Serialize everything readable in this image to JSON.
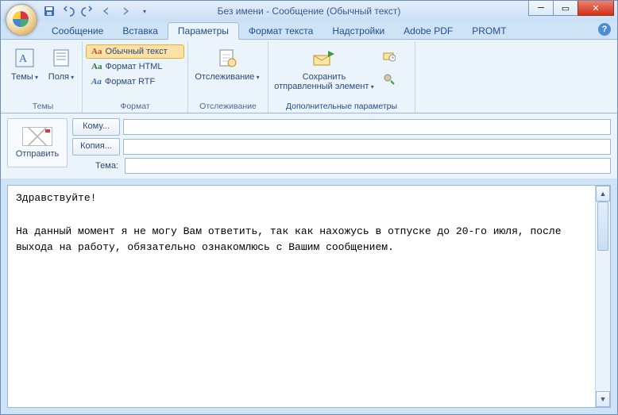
{
  "title": "Без имени - Сообщение (Обычный текст)",
  "tabs": [
    "Сообщение",
    "Вставка",
    "Параметры",
    "Формат текста",
    "Надстройки",
    "Adobe PDF",
    "PROMT"
  ],
  "activeTab": 2,
  "ribbon": {
    "themes": {
      "label": "Темы",
      "group": "Темы"
    },
    "fields": {
      "label": "Поля"
    },
    "format": {
      "plain": "Обычный текст",
      "html": "Формат HTML",
      "rtf": "Формат RTF",
      "group": "Формат"
    },
    "tracking": {
      "label": "Отслеживание",
      "group": "Отслеживание"
    },
    "save": {
      "label": "Сохранить\nотправленный элемент",
      "group": "Дополнительные параметры"
    }
  },
  "compose": {
    "send": "Отправить",
    "to": "Кому...",
    "cc": "Копия...",
    "subjectLabel": "Тема:",
    "subject": ""
  },
  "body": "Здравствуйте!\n\nНа данный момент я не могу Вам ответить, так как нахожусь в отпуске до 20-го июля, после выхода на работу, обязательно ознакомлюсь с Вашим сообщением."
}
